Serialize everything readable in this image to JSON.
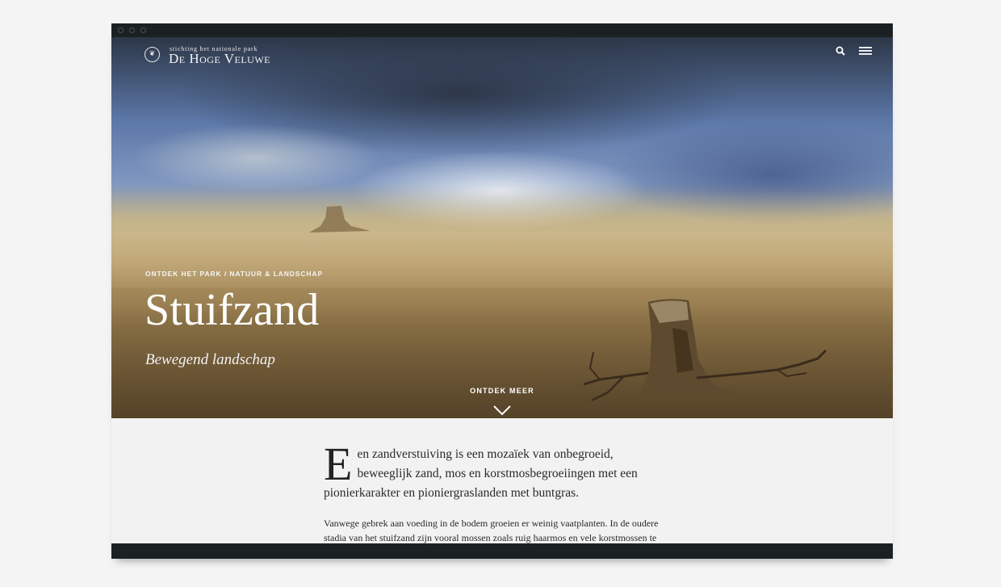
{
  "logo": {
    "subtitle": "stichting het nationale park",
    "name": "De Hoge Veluwe",
    "emblem": "❦"
  },
  "header": {
    "search_icon": "search-icon",
    "menu_icon": "hamburger-menu-icon"
  },
  "hero": {
    "breadcrumb": "ONTDEK HET PARK / NATUUR & LANDSCHAP",
    "title": "Stuifzand",
    "subtitle": "Bewegend landschap",
    "discover_label": "ONTDEK MEER",
    "discover_icon": "chevron-down-icon"
  },
  "article": {
    "dropcap": "E",
    "lead_rest": "en zandverstuiving is een mozaïek van onbegroeid, beweeglijk zand, mos en korstmosbegroeiingen met een pionierkarakter en pioniergraslanden met buntgras.",
    "body": "Vanwege gebrek aan voeding in de bodem groeien er weinig vaatplanten. In de oudere stadia van het stuifzand zijn vooral mossen zoals ruig haarmos en vele korstmossen te"
  },
  "colors": {
    "frame": "#1b2123",
    "page_background": "#f2f2f2",
    "text": "#2a2a2a"
  }
}
